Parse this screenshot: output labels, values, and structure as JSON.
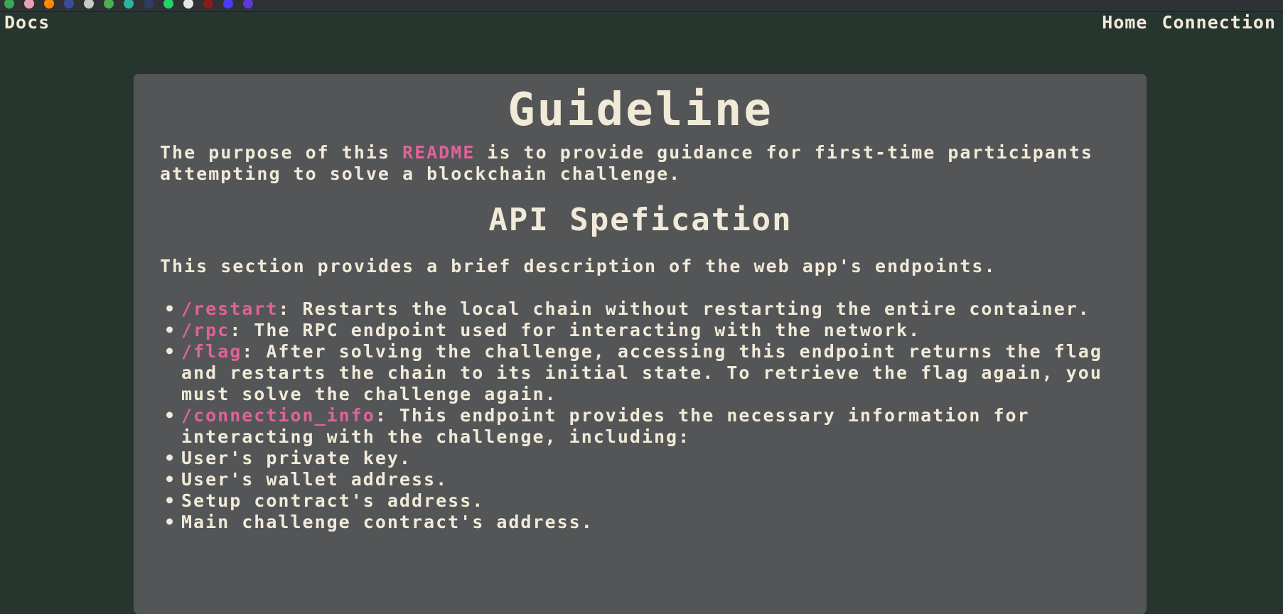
{
  "browser": {
    "bookmarks": [
      {
        "icon": "mail-icon",
        "color": "#3aa757"
      },
      {
        "icon": "pig-icon",
        "color": "#e8a0b8"
      },
      {
        "icon": "firefox-icon",
        "color": "#ff8a00"
      },
      {
        "icon": "radar-icon",
        "color": "#3b4b9c"
      },
      {
        "icon": "drive-icon",
        "color": "#c8c8c8"
      },
      {
        "icon": "hexagon-icon",
        "color": "#4caf50"
      },
      {
        "icon": "runner-icon",
        "color": "#2ab5a0"
      },
      {
        "icon": "house-icon",
        "color": "#2c3e66"
      },
      {
        "icon": "whatsapp-icon",
        "color": "#25d366"
      },
      {
        "icon": "github-icon",
        "color": "#e6e6e6"
      },
      {
        "icon": "bug-icon",
        "color": "#8b1a1a"
      },
      {
        "icon": "b-logo-icon",
        "color": "#4a3aff"
      },
      {
        "icon": "diamond-icon",
        "color": "#5b3ad6"
      }
    ]
  },
  "nav": {
    "brand": "Docs",
    "links": [
      "Home",
      "Connection"
    ]
  },
  "colors": {
    "background": "#27352f",
    "card": "#545556",
    "text": "#f1ead9",
    "highlight": "#e0629a"
  },
  "content": {
    "title": "Guideline",
    "intro_before": "The purpose of this ",
    "intro_highlight": "README",
    "intro_after": " is to provide guidance for first-time participants attempting to solve a blockchain challenge.",
    "api_title": "API Spefication",
    "api_desc": "This section provides a brief description of the web app's endpoints.",
    "endpoints": [
      {
        "path": "/restart",
        "desc": ": Restarts the local chain without restarting the entire container."
      },
      {
        "path": "/rpc",
        "desc": ": The RPC endpoint used for interacting with the network."
      },
      {
        "path": "/flag",
        "desc": ": After solving the challenge, accessing this endpoint returns the flag and restarts the chain to its initial state. To retrieve the flag again, you must solve the challenge again."
      },
      {
        "path": "/connection_info",
        "desc": ": This endpoint provides the necessary information for interacting with the challenge, including:"
      }
    ],
    "subitems": [
      "User's private key.",
      "User's wallet address.",
      "Setup contract's address.",
      "Main challenge contract's address."
    ]
  }
}
